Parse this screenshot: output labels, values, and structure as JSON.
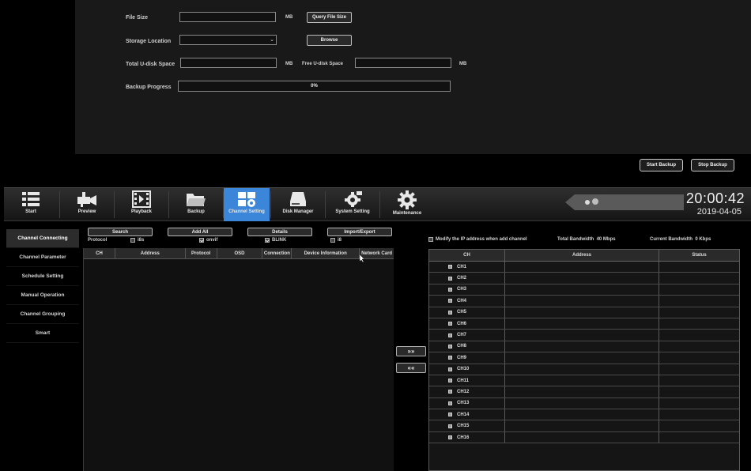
{
  "backup": {
    "file_size_label": "File Size",
    "file_size_value": "",
    "file_size_unit": "MB",
    "query_button": "Query File Size",
    "storage_label": "Storage Location",
    "storage_value": "",
    "browse_button": "Browse",
    "total_space_label": "Total U-disk Space",
    "total_space_value": "",
    "total_space_unit": "MB",
    "free_space_label": "Free U-disk Space",
    "free_space_value": "",
    "free_space_unit": "MB",
    "progress_label": "Backup Progress",
    "progress_text": "0%",
    "progress_value": 0,
    "start_button": "Start Backup",
    "stop_button": "Stop Backup"
  },
  "toolbar": {
    "items": [
      {
        "label": "Start",
        "icon": "list-icon"
      },
      {
        "label": "Preview",
        "icon": "camera-icon"
      },
      {
        "label": "Playback",
        "icon": "film-icon"
      },
      {
        "label": "Backup",
        "icon": "folder-icon"
      },
      {
        "label": "Channel Setting",
        "icon": "channel-setting-icon"
      },
      {
        "label": "Disk Manager",
        "icon": "disk-icon"
      },
      {
        "label": "System Setting",
        "icon": "system-gear-icon"
      },
      {
        "label": "Maintenance",
        "icon": "gear-icon"
      }
    ],
    "active_index": 4,
    "clock_time": "20:00:42",
    "clock_date": "2019-04-05"
  },
  "sidebar": {
    "items": [
      {
        "label": "Channel Connecting"
      },
      {
        "label": "Channel Parameter"
      },
      {
        "label": "Schedule Setting"
      },
      {
        "label": "Manual Operation"
      },
      {
        "label": "Channel Grouping"
      },
      {
        "label": "Smart"
      }
    ],
    "active_index": 0
  },
  "device_panel": {
    "search_button": "Search",
    "add_all_button": "Add All",
    "details_button": "Details",
    "import_export_button": "Import/Export",
    "protocol_label": "Protocol",
    "protocols": [
      {
        "label": "i8s",
        "checked": false
      },
      {
        "label": "onvif",
        "checked": true
      },
      {
        "label": "BLINK",
        "checked": true
      },
      {
        "label": "i8",
        "checked": false
      }
    ],
    "columns": [
      "CH",
      "Address",
      "Protocol",
      "OSD",
      "Connection",
      "Device Information",
      "Network Card"
    ]
  },
  "transfer": {
    "add_label": "»»",
    "remove_label": "««"
  },
  "channel_panel": {
    "modify_ip_label": "Modify the IP address when add channel",
    "modify_ip_checked": false,
    "total_bandwidth_label": "Total Bandwidth",
    "total_bandwidth_value": "40 Mbps",
    "current_bandwidth_label": "Current Bandwidth",
    "current_bandwidth_value": "0 Kbps",
    "columns": [
      "CH",
      "Address",
      "Status"
    ],
    "rows": [
      {
        "ch": "CH1",
        "address": "",
        "status": ""
      },
      {
        "ch": "CH2",
        "address": "",
        "status": ""
      },
      {
        "ch": "CH3",
        "address": "",
        "status": ""
      },
      {
        "ch": "CH4",
        "address": "",
        "status": ""
      },
      {
        "ch": "CH5",
        "address": "",
        "status": ""
      },
      {
        "ch": "CH6",
        "address": "",
        "status": ""
      },
      {
        "ch": "CH7",
        "address": "",
        "status": ""
      },
      {
        "ch": "CH8",
        "address": "",
        "status": ""
      },
      {
        "ch": "CH9",
        "address": "",
        "status": ""
      },
      {
        "ch": "CH10",
        "address": "",
        "status": ""
      },
      {
        "ch": "CH11",
        "address": "",
        "status": ""
      },
      {
        "ch": "CH12",
        "address": "",
        "status": ""
      },
      {
        "ch": "CH13",
        "address": "",
        "status": ""
      },
      {
        "ch": "CH14",
        "address": "",
        "status": ""
      },
      {
        "ch": "CH15",
        "address": "",
        "status": ""
      },
      {
        "ch": "CH16",
        "address": "",
        "status": ""
      }
    ]
  },
  "colors": {
    "accent": "#3b86d9",
    "progress": "#2e5fa8",
    "background": "#000000"
  }
}
